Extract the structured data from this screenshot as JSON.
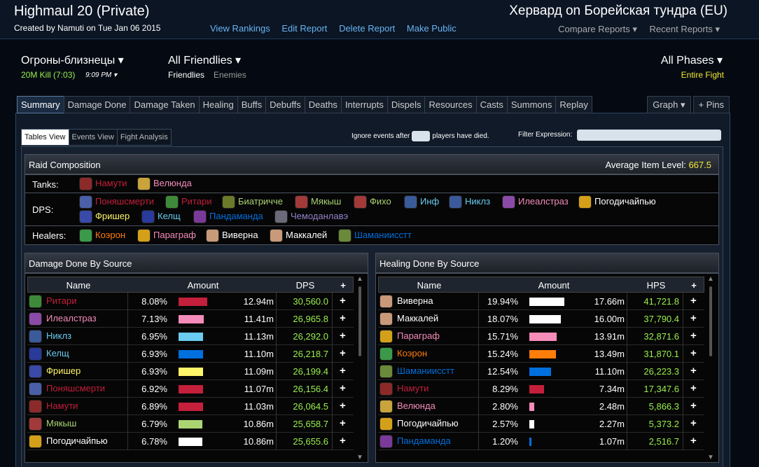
{
  "header": {
    "title": "Highmaul 20 (Private)",
    "created": "Created by Namuti on Tue Jan 06 2015",
    "links": [
      "View Rankings",
      "Edit Report",
      "Delete Report",
      "Make Public"
    ],
    "server": "Хервард on Борейская тундра (EU)",
    "menus": [
      "Compare Reports ▾",
      "Recent Reports ▾"
    ]
  },
  "filters": {
    "boss": "Огроны-близнецы ▾",
    "kill": "20M Kill (7:03)",
    "kill_date": "9:09 PM ▾",
    "friendlies": "All Friendlies ▾",
    "friendlies_tab": "Friendlies",
    "enemies_tab": "Enemies",
    "phases": "All Phases ▾",
    "entire_fight": "Entire Fight"
  },
  "tabs": [
    "Summary",
    "Damage Done",
    "Damage Taken",
    "Healing",
    "Buffs",
    "Debuffs",
    "Deaths",
    "Interrupts",
    "Dispels",
    "Resources",
    "Casts",
    "Summons",
    "Replay"
  ],
  "graph_tabs": [
    "Graph ▾",
    "+ Pins"
  ],
  "subtabs": [
    "Tables View",
    "Events View",
    "Fight Analysis"
  ],
  "ignore_prefix": "Ignore events after",
  "ignore_suffix": "players have died.",
  "filter_label": "Filter Expression:",
  "raid": {
    "title": "Raid Composition",
    "avg_label": "Average Item Level:",
    "avg_value": "667.5",
    "tanks_label": "Tanks:",
    "dps_label": "DPS:",
    "healers_label": "Healers:",
    "tanks": [
      {
        "name": "Намути",
        "color": "#c41f3b",
        "icon": "#8c2a2a"
      },
      {
        "name": "Велюнда",
        "color": "#f58cba",
        "icon": "#c9a33b"
      }
    ],
    "dps_row1": [
      {
        "name": "Поняшсмерти",
        "color": "#c41f3b",
        "icon": "#4a5fa8"
      },
      {
        "name": "Ритари",
        "color": "#c41f3b",
        "icon": "#3f8a3a"
      },
      {
        "name": "Биатриччe",
        "color": "#abd473",
        "icon": "#6a7a2a"
      },
      {
        "name": "Мякыш",
        "color": "#abd473",
        "icon": "#a23a3a"
      },
      {
        "name": "Фихо",
        "color": "#abd473",
        "icon": "#a23a3a"
      },
      {
        "name": "Инф",
        "color": "#69ccf0",
        "icon": "#3a5a9a"
      },
      {
        "name": "Никлз",
        "color": "#69ccf0",
        "icon": "#3a5a9a"
      },
      {
        "name": "Илеалстраз",
        "color": "#f58cba",
        "icon": "#8a4aa8"
      },
      {
        "name": "Погодичайпью",
        "color": "#ffffff",
        "icon": "#d4a01a"
      }
    ],
    "dps_row2": [
      {
        "name": "Фришер",
        "color": "#fff569",
        "icon": "#3a4aa8"
      },
      {
        "name": "Келщ",
        "color": "#69ccf0",
        "icon": "#2a3a9a"
      },
      {
        "name": "Пандаманда",
        "color": "#0070de",
        "icon": "#7a3a9a"
      },
      {
        "name": "Чемоданлавэ",
        "color": "#9482c9",
        "icon": "#6a6a7a"
      }
    ],
    "healers": [
      {
        "name": "Коэрон",
        "color": "#ff7d0a",
        "icon": "#3a9a4a"
      },
      {
        "name": "Параграф",
        "color": "#f58cba",
        "icon": "#d4a01a"
      },
      {
        "name": "Виверна",
        "color": "#ffffff",
        "icon": "#c89a7a"
      },
      {
        "name": "Маккалей",
        "color": "#ffffff",
        "icon": "#c89a7a"
      },
      {
        "name": "Шаманиисстт",
        "color": "#0070de",
        "icon": "#6a8a3a"
      }
    ]
  },
  "damage": {
    "title": "Damage Done By Source",
    "headers": [
      "Name",
      "Amount",
      "DPS",
      "+"
    ],
    "rows": [
      {
        "name": "Ритари",
        "color": "#c41f3b",
        "icon": "#3f8a3a",
        "pct": "8.08%",
        "frac": 0.81,
        "bar": "#c41f3b",
        "amount": "12.94m",
        "rate": "30,560.0"
      },
      {
        "name": "Илеалстраз",
        "color": "#f58cba",
        "icon": "#8a4aa8",
        "pct": "7.13%",
        "frac": 0.71,
        "bar": "#f58cba",
        "amount": "11.41m",
        "rate": "26,965.8"
      },
      {
        "name": "Никлз",
        "color": "#69ccf0",
        "icon": "#3a5a9a",
        "pct": "6.95%",
        "frac": 0.7,
        "bar": "#69ccf0",
        "amount": "11.13m",
        "rate": "26,292.0"
      },
      {
        "name": "Келщ",
        "color": "#69ccf0",
        "icon": "#2a3a9a",
        "pct": "6.93%",
        "frac": 0.69,
        "bar": "#0070de",
        "amount": "11.10m",
        "rate": "26,218.7"
      },
      {
        "name": "Фришер",
        "color": "#fff569",
        "icon": "#3a4aa8",
        "pct": "6.93%",
        "frac": 0.69,
        "bar": "#fff569",
        "amount": "11.09m",
        "rate": "26,199.4"
      },
      {
        "name": "Поняшсмерти",
        "color": "#c41f3b",
        "icon": "#4a5fa8",
        "pct": "6.92%",
        "frac": 0.69,
        "bar": "#c41f3b",
        "amount": "11.07m",
        "rate": "26,156.4"
      },
      {
        "name": "Намути",
        "color": "#c41f3b",
        "icon": "#8c2a2a",
        "pct": "6.89%",
        "frac": 0.69,
        "bar": "#c41f3b",
        "amount": "11.03m",
        "rate": "26,064.5"
      },
      {
        "name": "Мякыш",
        "color": "#abd473",
        "icon": "#a23a3a",
        "pct": "6.79%",
        "frac": 0.68,
        "bar": "#abd473",
        "amount": "10.86m",
        "rate": "25,658.7"
      },
      {
        "name": "Погодичайпью",
        "color": "#ffffff",
        "icon": "#d4a01a",
        "pct": "6.78%",
        "frac": 0.68,
        "bar": "#ffffff",
        "amount": "10.86m",
        "rate": "25,655.6"
      }
    ]
  },
  "healing": {
    "title": "Healing Done By Source",
    "headers": [
      "Name",
      "Amount",
      "HPS",
      "+"
    ],
    "rows": [
      {
        "name": "Виверна",
        "color": "#ffffff",
        "icon": "#c89a7a",
        "pct": "19.94%",
        "frac": 0.99,
        "bar": "#ffffff",
        "amount": "17.66m",
        "rate": "41,721.8"
      },
      {
        "name": "Маккалей",
        "color": "#ffffff",
        "icon": "#c89a7a",
        "pct": "18.07%",
        "frac": 0.9,
        "bar": "#ffffff",
        "amount": "16.00m",
        "rate": "37,790.4"
      },
      {
        "name": "Параграф",
        "color": "#f58cba",
        "icon": "#d4a01a",
        "pct": "15.71%",
        "frac": 0.78,
        "bar": "#f58cba",
        "amount": "13.91m",
        "rate": "32,871.6"
      },
      {
        "name": "Коэрон",
        "color": "#ff7d0a",
        "icon": "#3a9a4a",
        "pct": "15.24%",
        "frac": 0.76,
        "bar": "#ff7d0a",
        "amount": "13.49m",
        "rate": "31,870.1"
      },
      {
        "name": "Шаманиисстт",
        "color": "#0070de",
        "icon": "#6a8a3a",
        "pct": "12.54%",
        "frac": 0.62,
        "bar": "#0070de",
        "amount": "11.10m",
        "rate": "26,223.3"
      },
      {
        "name": "Намути",
        "color": "#c41f3b",
        "icon": "#8c2a2a",
        "pct": "8.29%",
        "frac": 0.41,
        "bar": "#c41f3b",
        "amount": "7.34m",
        "rate": "17,347.6"
      },
      {
        "name": "Велюнда",
        "color": "#f58cba",
        "icon": "#c9a33b",
        "pct": "2.80%",
        "frac": 0.14,
        "bar": "#f58cba",
        "amount": "2.48m",
        "rate": "5,866.3"
      },
      {
        "name": "Погодичайпью",
        "color": "#ffffff",
        "icon": "#d4a01a",
        "pct": "2.57%",
        "frac": 0.13,
        "bar": "#ffffff",
        "amount": "2.27m",
        "rate": "5,373.2"
      },
      {
        "name": "Пандаманда",
        "color": "#0070de",
        "icon": "#7a3a9a",
        "pct": "1.20%",
        "frac": 0.06,
        "bar": "#0070de",
        "amount": "1.07m",
        "rate": "2,516.7"
      }
    ]
  }
}
